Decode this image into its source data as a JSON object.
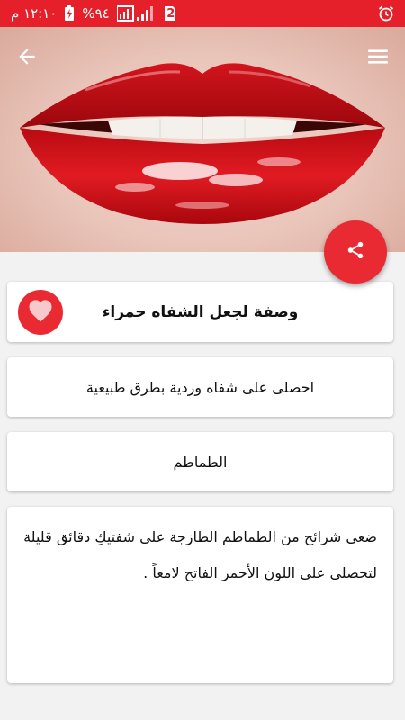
{
  "status_bar": {
    "time": "١٢:١٠ م",
    "battery": "%٩٤",
    "sim_slot": "2",
    "icons": [
      "alarm-icon",
      "sim-icon",
      "signal-icon",
      "battery-charging-icon"
    ]
  },
  "toolbar": {
    "back_icon": "arrow-left-icon",
    "menu_icon": "hamburger-menu-icon"
  },
  "fab": {
    "icon": "share-icon"
  },
  "recipe": {
    "title": "وصفة لجعل الشفاه حمراء",
    "favorite_icon": "heart-icon",
    "subtitle": "احصلى على شفاه وردية بطرق طبيعية",
    "ingredient": "الطماطم",
    "description": "ضعى شرائح من الطماطم الطازجة على شفتيكِ دقائق قليلة لتحصلى على اللون الأحمر الفاتح لامعاً ."
  },
  "colors": {
    "accent": "#e5202a",
    "fab": "#ea2a33",
    "background": "#f2f2f2",
    "card": "#ffffff"
  }
}
